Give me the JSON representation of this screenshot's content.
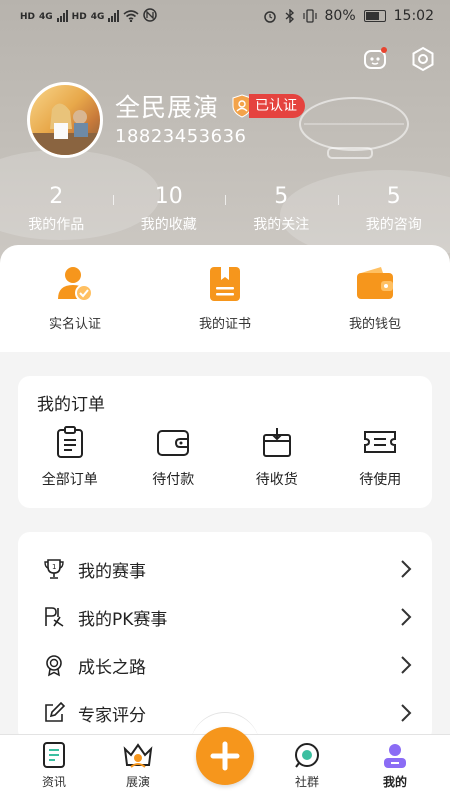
{
  "status_bar": {
    "left_labels": [
      "HD",
      "4G",
      "HD",
      "4G"
    ],
    "battery": "80%",
    "time": "15:02"
  },
  "profile": {
    "name": "全民展演",
    "verified_label": "已认证",
    "phone": "18823453636"
  },
  "stats": [
    {
      "value": "2",
      "label": "我的作品"
    },
    {
      "value": "10",
      "label": "我的收藏"
    },
    {
      "value": "5",
      "label": "我的关注"
    },
    {
      "value": "5",
      "label": "我的咨询"
    }
  ],
  "quick_actions": [
    {
      "label": "实名认证",
      "icon": "user-verify-icon"
    },
    {
      "label": "我的证书",
      "icon": "certificate-icon"
    },
    {
      "label": "我的钱包",
      "icon": "wallet-icon"
    }
  ],
  "orders": {
    "title": "我的订单",
    "items": [
      {
        "label": "全部订单",
        "icon": "clipboard-icon"
      },
      {
        "label": "待付款",
        "icon": "wallet-outline-icon"
      },
      {
        "label": "待收货",
        "icon": "package-icon"
      },
      {
        "label": "待使用",
        "icon": "ticket-icon"
      }
    ]
  },
  "menu": [
    {
      "label": "我的赛事",
      "icon": "trophy-icon"
    },
    {
      "label": "我的PK赛事",
      "icon": "pk-icon"
    },
    {
      "label": "成长之路",
      "icon": "medal-icon"
    },
    {
      "label": "专家评分",
      "icon": "edit-icon"
    }
  ],
  "tabs": [
    {
      "label": "资讯",
      "icon": "news-icon"
    },
    {
      "label": "展演",
      "icon": "performance-icon"
    },
    {
      "label": "社群",
      "icon": "community-icon"
    },
    {
      "label": "我的",
      "icon": "me-icon"
    }
  ],
  "colors": {
    "accent_orange": "#f6961c",
    "badge_red": "#e5433f",
    "active_tab": "#8b6cf5"
  }
}
